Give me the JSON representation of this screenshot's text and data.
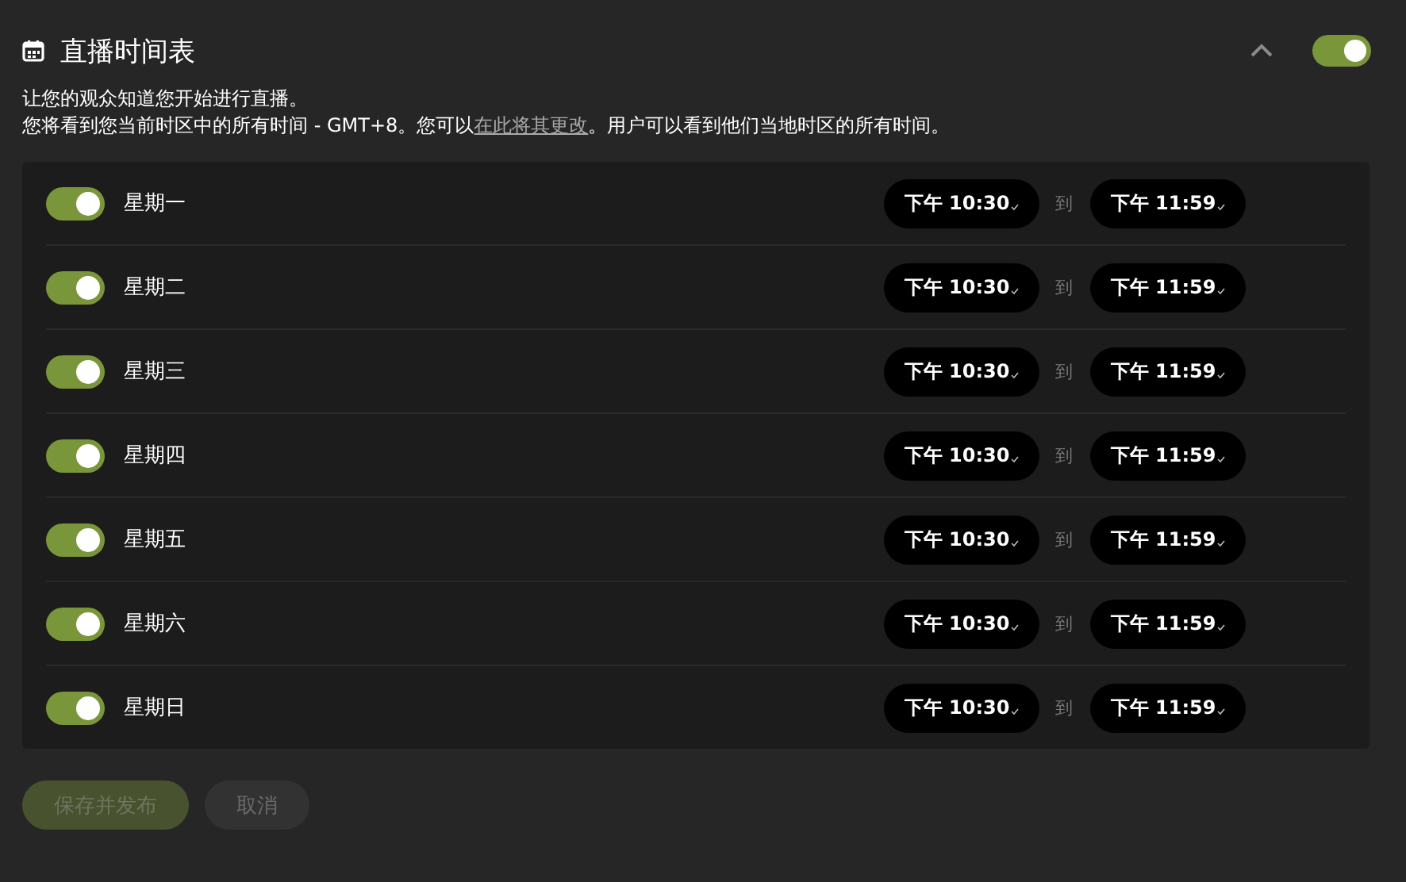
{
  "header": {
    "title": "直播时间表",
    "expanded": true,
    "enabled": true
  },
  "description": {
    "line_1": "让您的观众知道您开始进行直播。",
    "line_2_before": "您将看到您当前时区中的所有时间 - GMT+8。您可以",
    "line_2_link": "在此将其更改",
    "line_2_after": "。用户可以看到他们当地时区的所有时间。"
  },
  "days": [
    {
      "name": "星期一",
      "on": true,
      "start": "下午 10:30",
      "separator": "到",
      "end": "下午 11:59"
    },
    {
      "name": "星期二",
      "on": true,
      "start": "下午 10:30",
      "separator": "到",
      "end": "下午 11:59"
    },
    {
      "name": "星期三",
      "on": true,
      "start": "下午 10:30",
      "separator": "到",
      "end": "下午 11:59"
    },
    {
      "name": "星期四",
      "on": true,
      "start": "下午 10:30",
      "separator": "到",
      "end": "下午 11:59"
    },
    {
      "name": "星期五",
      "on": true,
      "start": "下午 10:30",
      "separator": "到",
      "end": "下午 11:59"
    },
    {
      "name": "星期六",
      "on": true,
      "start": "下午 10:30",
      "separator": "到",
      "end": "下午 11:59"
    },
    {
      "name": "星期日",
      "on": true,
      "start": "下午 10:30",
      "separator": "到",
      "end": "下午 11:59"
    }
  ],
  "buttons": [
    {
      "label": "保存并发布",
      "kind": "primary",
      "disabled": true
    },
    {
      "label": "取消",
      "kind": "secondary",
      "disabled": true
    }
  ]
}
